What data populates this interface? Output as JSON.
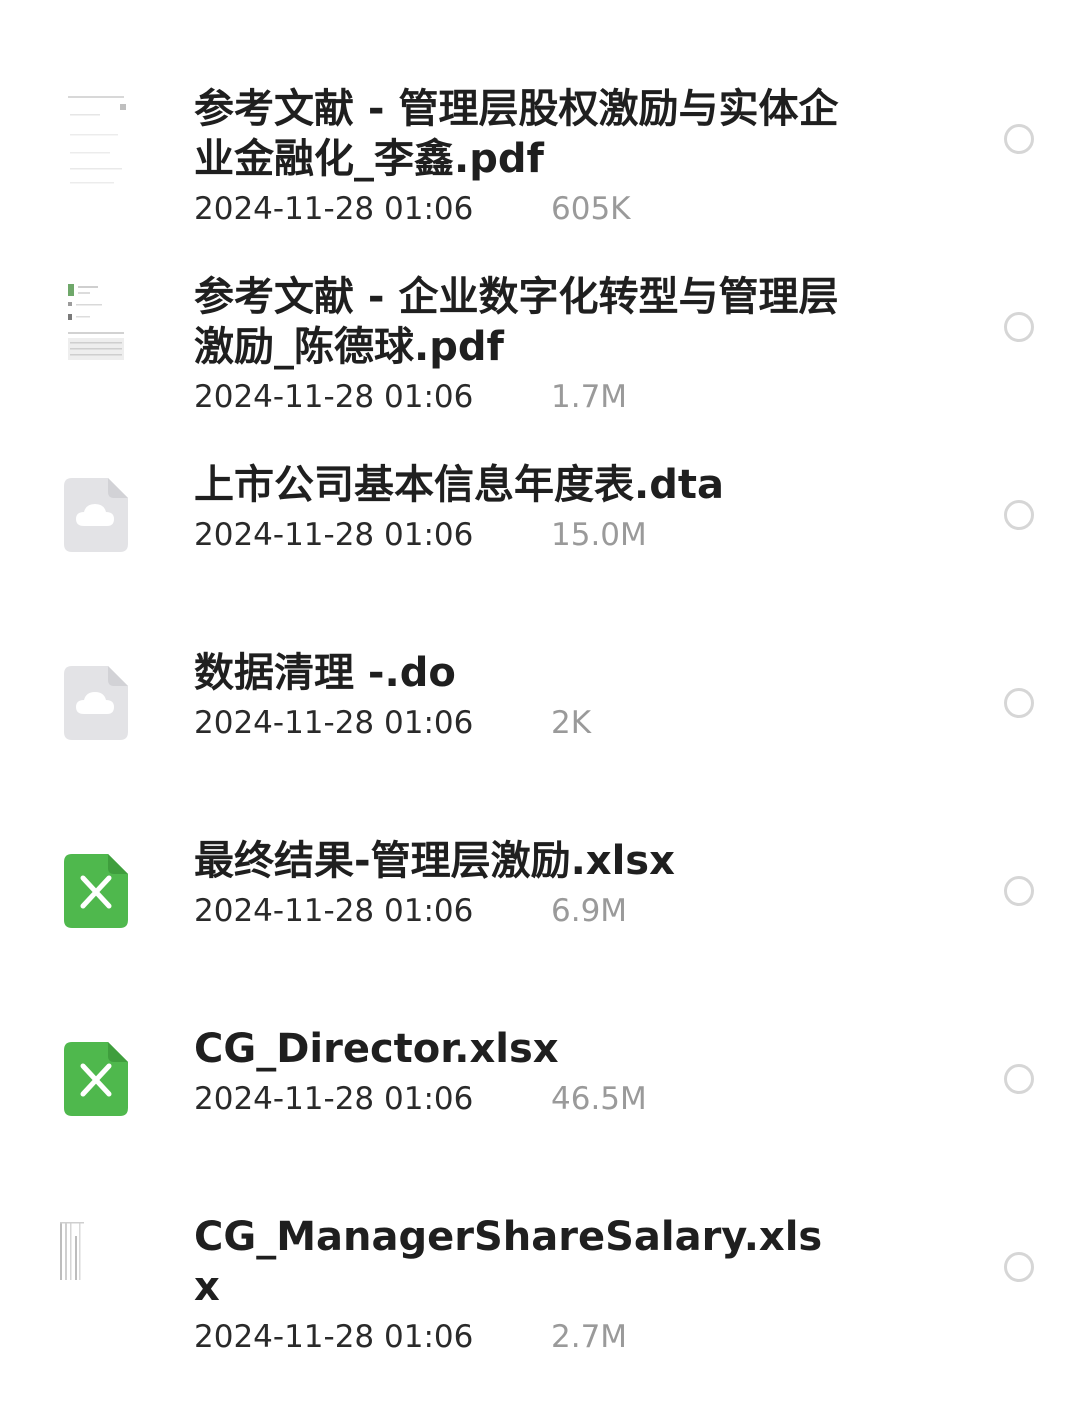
{
  "files": [
    {
      "name": "参考文献 - 管理层股权激励与实体企业金融化_李鑫.pdf",
      "date": "2024-11-28 01:06",
      "size": "605K",
      "icon": "pdf-thumbnail-icon"
    },
    {
      "name": "参考文献 - 企业数字化转型与管理层激励_陈德球.pdf",
      "date": "2024-11-28 01:06",
      "size": "1.7M",
      "icon": "pdf-thumbnail-icon"
    },
    {
      "name": "上市公司基本信息年度表.dta",
      "date": "2024-11-28 01:06",
      "size": "15.0M",
      "icon": "cloud-file-icon"
    },
    {
      "name": "数据清理 -.do",
      "date": "2024-11-28 01:06",
      "size": "2K",
      "icon": "cloud-file-icon"
    },
    {
      "name": "最终结果-管理层激励.xlsx",
      "date": "2024-11-28 01:06",
      "size": "6.9M",
      "icon": "excel-file-icon"
    },
    {
      "name": "CG_Director.xlsx",
      "date": "2024-11-28 01:06",
      "size": "46.5M",
      "icon": "excel-file-icon"
    },
    {
      "name": "CG_ManagerShareSalary.xlsx",
      "date": "2024-11-28 01:06",
      "size": "2.7M",
      "icon": "spreadsheet-thumbnail-icon"
    }
  ],
  "colors": {
    "excel_green": "#4fb84d",
    "cloud_file_grey": "#e3e3e6",
    "size_text": "#9a9a9a",
    "radio_border": "#d6d6d6"
  }
}
